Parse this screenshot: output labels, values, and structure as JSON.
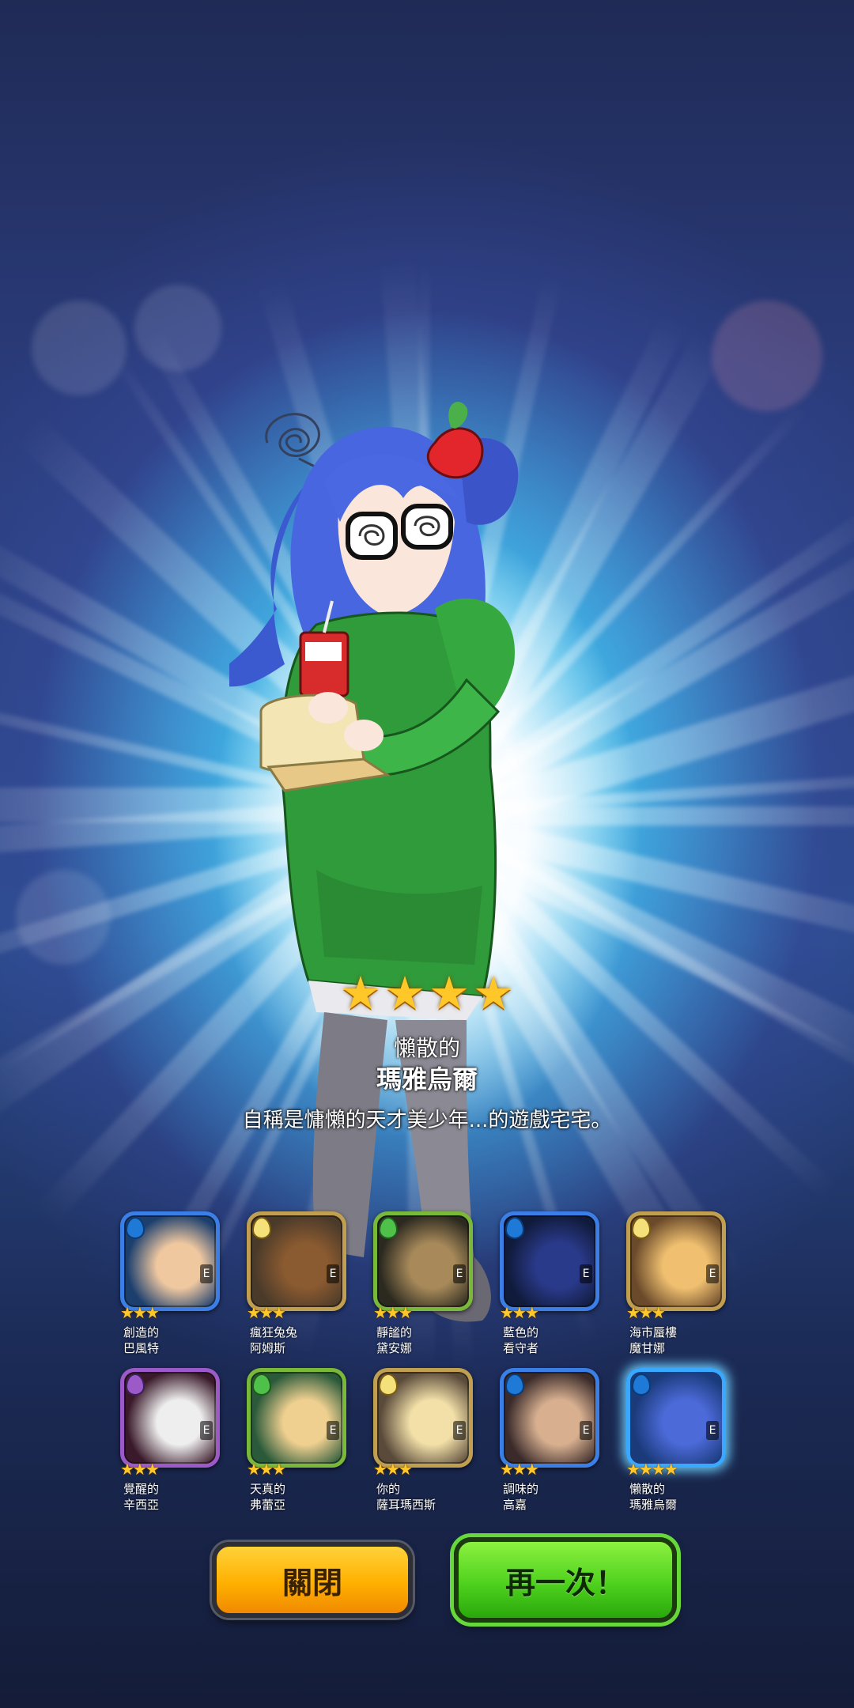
{
  "result": {
    "rarity_stars": 4,
    "title_prefix": "懶散的",
    "title_name": "瑪雅烏爾",
    "description": "自稱是慵懶的天才美少年...的遊戲宅宅。"
  },
  "cards": [
    {
      "prefix": "創造的",
      "name": "巴風特",
      "stars": "★★★",
      "element": "water"
    },
    {
      "prefix": "瘋狂兔兔",
      "name": "阿姆斯",
      "stars": "★★★",
      "element": "light"
    },
    {
      "prefix": "靜謐的",
      "name": "黛安娜",
      "stars": "★★★",
      "element": "nature"
    },
    {
      "prefix": "藍色的",
      "name": "看守者",
      "stars": "★★★",
      "element": "water"
    },
    {
      "prefix": "海市蜃樓",
      "name": "魔甘娜",
      "stars": "★★★",
      "element": "light"
    },
    {
      "prefix": "覺醒的",
      "name": "辛西亞",
      "stars": "★★★",
      "element": "dark"
    },
    {
      "prefix": "天真的",
      "name": "弗蕾亞",
      "stars": "★★★",
      "element": "nature"
    },
    {
      "prefix": "你的",
      "name": "薩耳瑪西斯",
      "stars": "★★★",
      "element": "light"
    },
    {
      "prefix": "調味的",
      "name": "高嘉",
      "stars": "★★★",
      "element": "water"
    },
    {
      "prefix": "懶散的",
      "name": "瑪雅烏爾",
      "stars": "★★★★",
      "element": "water"
    }
  ],
  "card_grade": "E",
  "buttons": {
    "close_label": "關閉",
    "again_label": "再一次！"
  },
  "colors": {
    "star": "#ffc727",
    "close_button": "#ffb000",
    "again_button": "#4fd21e"
  }
}
